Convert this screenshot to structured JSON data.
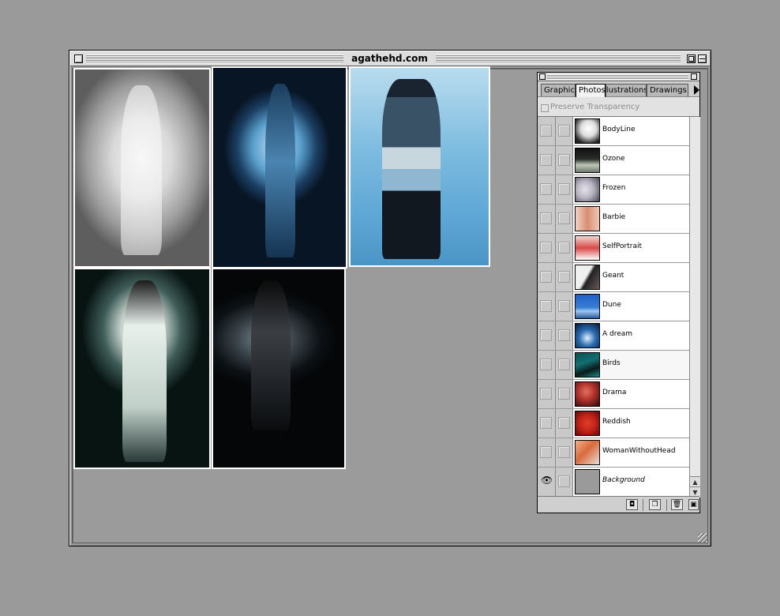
{
  "window": {
    "title": "agathehd.com"
  },
  "photos": [
    {
      "name": "photo-fog-figure-white"
    },
    {
      "name": "photo-fog-figure-blue"
    },
    {
      "name": "photo-woman-standing-blue"
    },
    {
      "name": "photo-fog-figure-green"
    },
    {
      "name": "photo-fog-figure-dark"
    }
  ],
  "palette": {
    "tabs": [
      {
        "label": "Graphics",
        "active": false
      },
      {
        "label": "Photos",
        "active": true
      },
      {
        "label": "Illustrations",
        "active": false
      },
      {
        "label": "Drawings",
        "active": false
      }
    ],
    "preserve_transparency_label": "Preserve Transparency",
    "layers": [
      {
        "name": "BodyLine",
        "visible": false,
        "thumb_color": "#e6e6e6"
      },
      {
        "name": "Ozone",
        "visible": false,
        "thumb_color": "#6f7a68"
      },
      {
        "name": "Frozen",
        "visible": false,
        "thumb_color": "#b9b5c2"
      },
      {
        "name": "Barbie",
        "visible": false,
        "thumb_color": "#d98d74"
      },
      {
        "name": "SelfPortrait",
        "visible": false,
        "thumb_color": "#d84a48"
      },
      {
        "name": "Geant",
        "visible": false,
        "thumb_color": "#6a5a5a"
      },
      {
        "name": "Dune",
        "visible": false,
        "thumb_color": "#3a7fd6"
      },
      {
        "name": "A dream",
        "visible": false,
        "thumb_color": "#2a6ab0"
      },
      {
        "name": "Birds",
        "visible": false,
        "thumb_color": "#126f72"
      },
      {
        "name": "Drama",
        "visible": false,
        "thumb_color": "#b0302a"
      },
      {
        "name": "Reddish",
        "visible": false,
        "thumb_color": "#c02218"
      },
      {
        "name": "WomanWithoutHead",
        "visible": false,
        "thumb_color": "#d86a3c"
      },
      {
        "name": "Background",
        "visible": true,
        "thumb_color": "#9a9a9a"
      }
    ]
  },
  "icons": {
    "eye": "eye-icon",
    "new_set": "new-layer-set-icon",
    "new_layer": "new-layer-icon",
    "trash": "trash-icon",
    "mask": "layer-mask-icon"
  }
}
